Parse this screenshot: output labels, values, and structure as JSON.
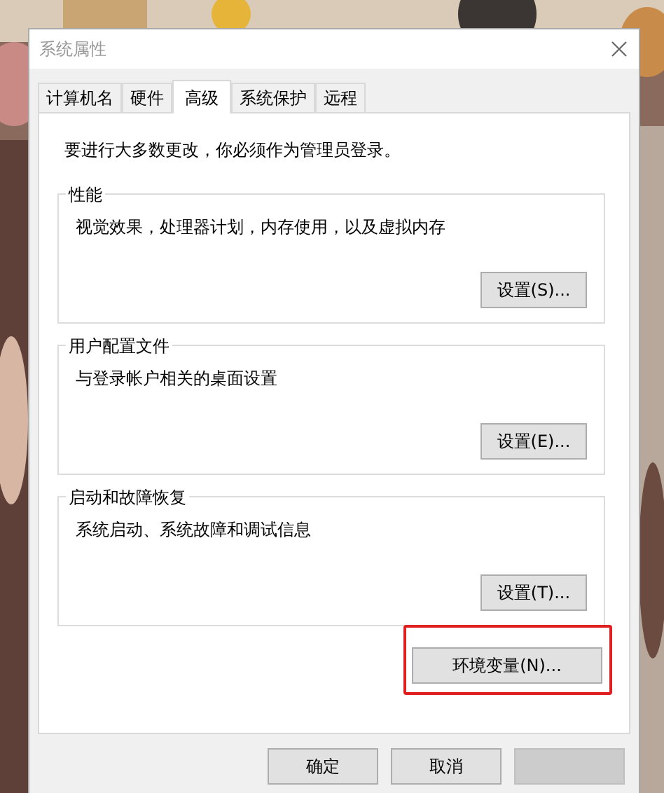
{
  "window": {
    "title": "系统属性"
  },
  "tabs": [
    {
      "label": "计算机名",
      "selected": false
    },
    {
      "label": "硬件",
      "selected": false
    },
    {
      "label": "高级",
      "selected": true
    },
    {
      "label": "系统保护",
      "selected": false
    },
    {
      "label": "远程",
      "selected": false
    }
  ],
  "notice": "要进行大多数更改，你必须作为管理员登录。",
  "groups": [
    {
      "title": "性能",
      "description": "视觉效果，处理器计划，内存使用，以及虚拟内存",
      "button": "设置(S)..."
    },
    {
      "title": "用户配置文件",
      "description": "与登录帐户相关的桌面设置",
      "button": "设置(E)..."
    },
    {
      "title": "启动和故障恢复",
      "description": "系统启动、系统故障和调试信息",
      "button": "设置(T)..."
    }
  ],
  "env_button": {
    "label": "环境变量(N)...",
    "highlighted": true
  },
  "footer_buttons": [
    {
      "label": "确定",
      "disabled": false
    },
    {
      "label": "取消",
      "disabled": false
    },
    {
      "disabled": true
    }
  ]
}
